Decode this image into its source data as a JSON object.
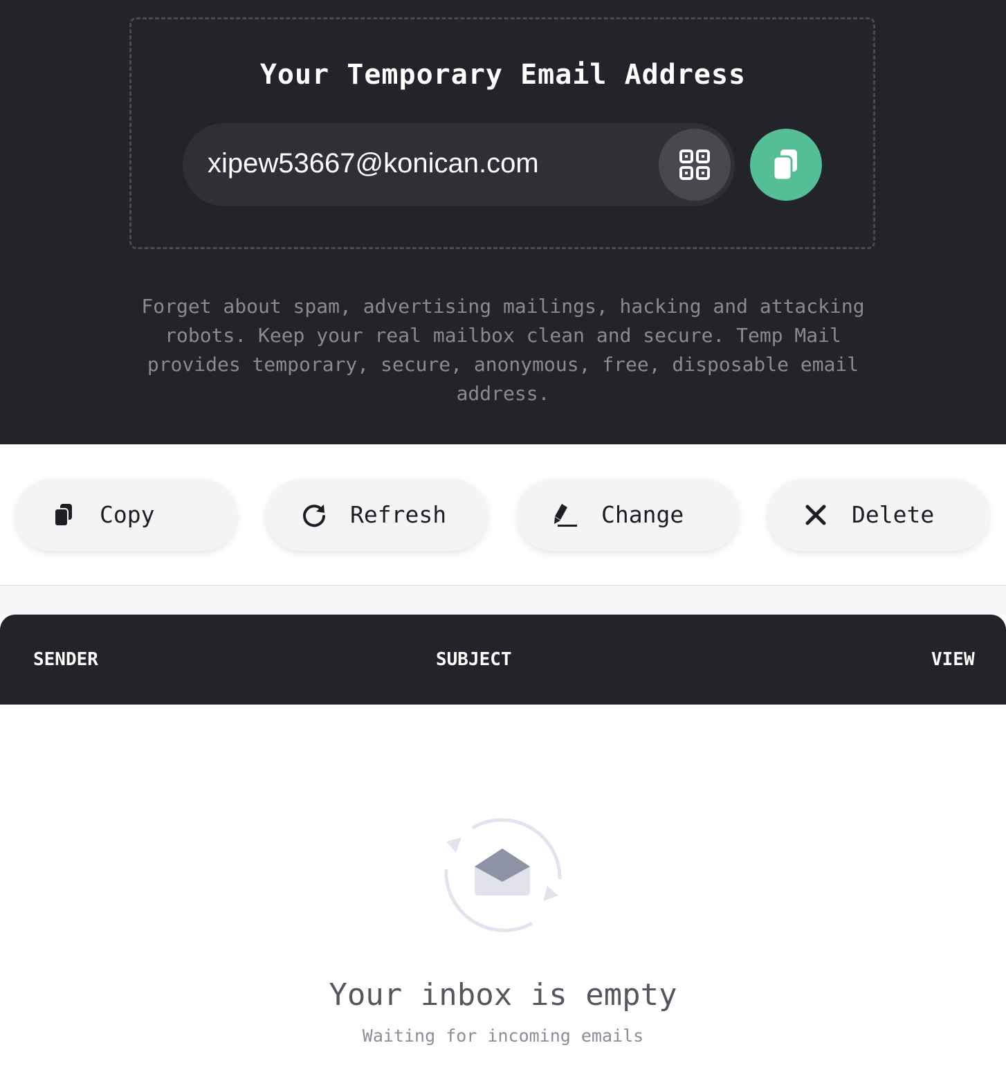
{
  "hero": {
    "title": "Your Temporary Email Address",
    "email": "xipew53667@konican.com",
    "description": "Forget about spam, advertising mailings, hacking and attacking robots. Keep your real mailbox clean and secure. Temp Mail provides temporary, secure, anonymous, free, disposable email address.",
    "qr_icon": "qr-code-icon",
    "copy_icon": "copy-icon",
    "accent_color": "#55be96"
  },
  "actions": [
    {
      "label": "Copy",
      "icon": "copy-icon"
    },
    {
      "label": "Refresh",
      "icon": "refresh-icon"
    },
    {
      "label": "Change",
      "icon": "edit-pen-icon"
    },
    {
      "label": "Delete",
      "icon": "close-icon"
    }
  ],
  "inbox": {
    "columns": [
      "SENDER",
      "SUBJECT",
      "VIEW"
    ],
    "empty_title": "Your inbox is empty",
    "empty_subtitle": "Waiting for incoming emails",
    "empty_icon": "envelope-refresh-icon"
  }
}
